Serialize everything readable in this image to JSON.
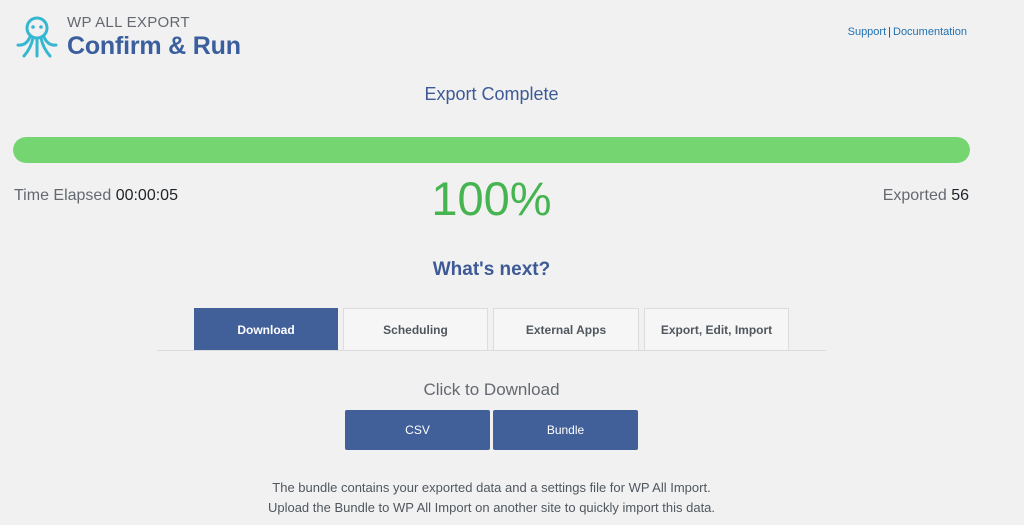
{
  "header": {
    "brand": "WP ALL EXPORT",
    "title": "Confirm & Run",
    "links": {
      "support": "Support",
      "separator": "|",
      "documentation": "Documentation"
    },
    "logo_icon": "octopus-logo-icon",
    "logo_color": "#35b6d1"
  },
  "status": {
    "message": "Export Complete",
    "progress_fraction": 1.0,
    "progress_color": "#75d571",
    "time_label": "Time Elapsed",
    "time_value": "00:00:05",
    "percent_text": "100%",
    "exported_label": "Exported",
    "exported_value": "56"
  },
  "next": {
    "heading": "What's next?",
    "tabs": [
      {
        "label": "Download",
        "active": true
      },
      {
        "label": "Scheduling",
        "active": false
      },
      {
        "label": "External Apps",
        "active": false
      },
      {
        "label": "Export, Edit, Import",
        "active": false
      }
    ]
  },
  "download": {
    "heading": "Click to Download",
    "buttons": [
      "CSV",
      "Bundle"
    ],
    "info_line1": "The bundle contains your exported data and a settings file for WP All Import.",
    "info_line2": "Upload the Bundle to WP All Import on another site to quickly import this data."
  },
  "colors": {
    "accent": "#41609a",
    "title": "#3b5f9e",
    "percent": "#46b450"
  }
}
